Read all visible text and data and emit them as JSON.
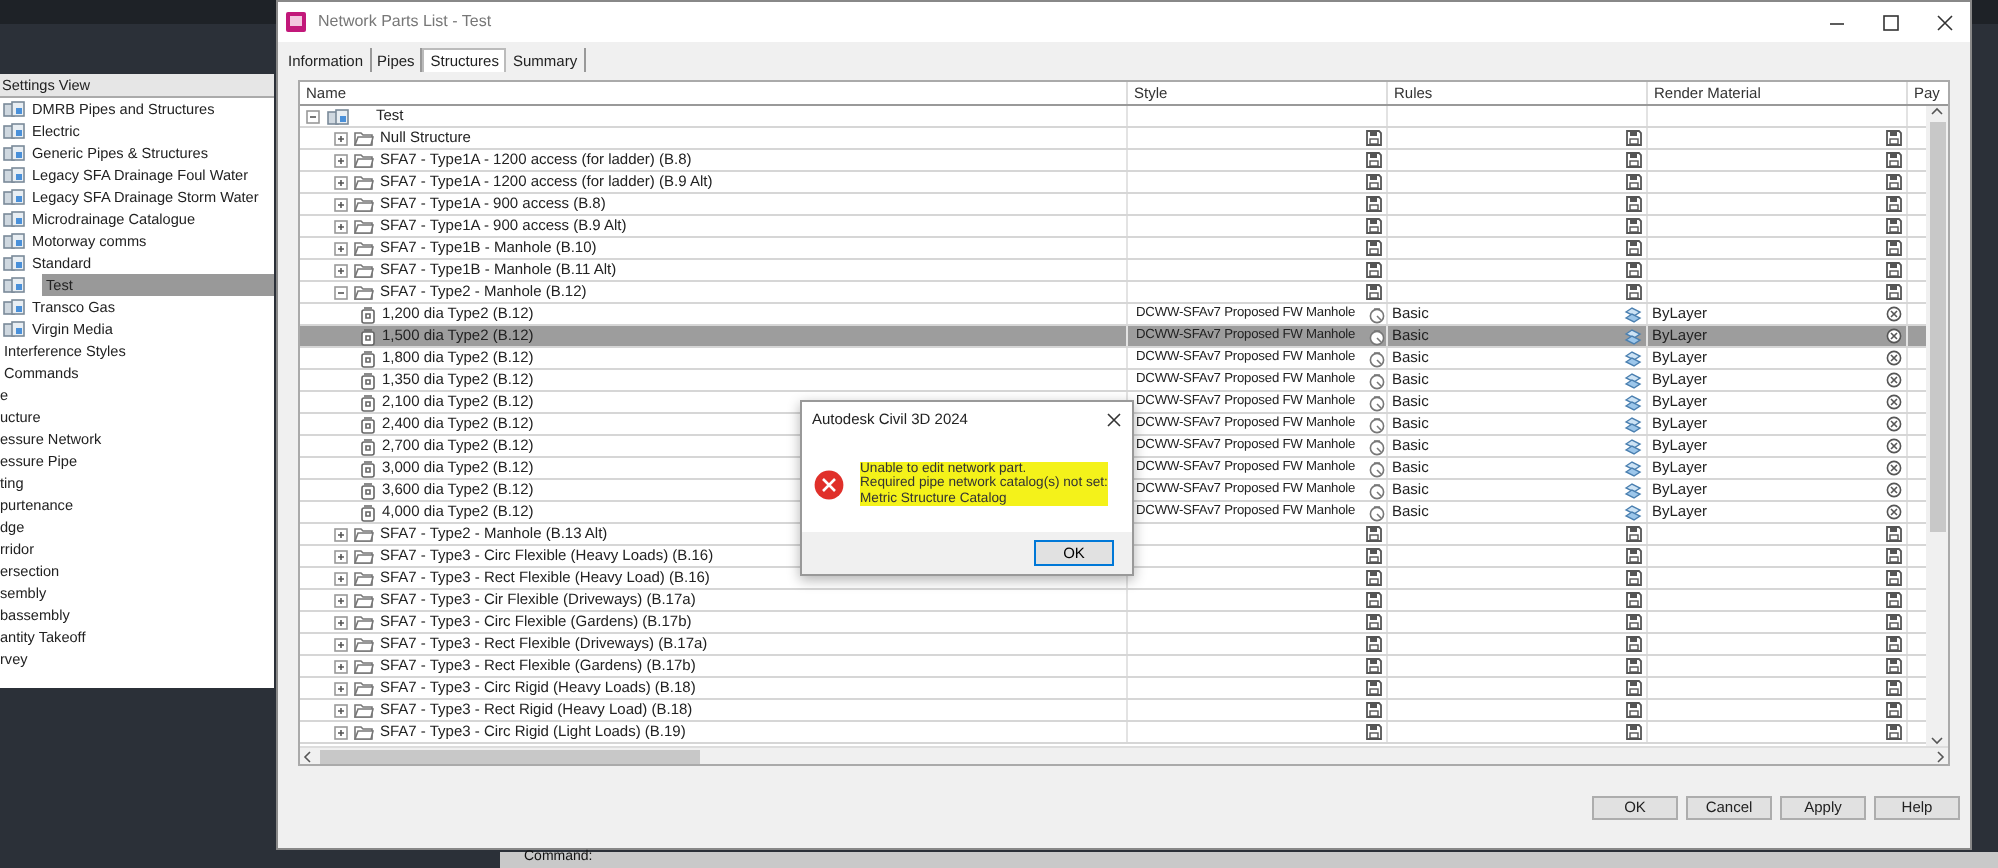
{
  "settings_view": {
    "header": "Settings View",
    "entries": [
      {
        "kind": "parts-list",
        "label": "DMRB Pipes and Structures",
        "selected": false
      },
      {
        "kind": "parts-list",
        "label": "Electric",
        "selected": false
      },
      {
        "kind": "parts-list",
        "label": "Generic Pipes & Structures",
        "selected": false
      },
      {
        "kind": "parts-list",
        "label": "Legacy SFA Drainage Foul Water",
        "selected": false
      },
      {
        "kind": "parts-list",
        "label": "Legacy SFA Drainage Storm Water",
        "selected": false
      },
      {
        "kind": "parts-list",
        "label": "Microdrainage Catalogue",
        "selected": false
      },
      {
        "kind": "parts-list",
        "label": "Motorway comms",
        "selected": false
      },
      {
        "kind": "parts-list",
        "label": "Standard",
        "selected": false
      },
      {
        "kind": "parts-list",
        "label": "Test",
        "selected": true
      },
      {
        "kind": "parts-list",
        "label": "Transco Gas",
        "selected": false
      },
      {
        "kind": "parts-list",
        "label": "Virgin Media",
        "selected": false
      },
      {
        "kind": "collection",
        "label": "Interference Styles",
        "selected": false
      },
      {
        "kind": "collection",
        "label": "Commands",
        "selected": false
      },
      {
        "kind": "object",
        "label": "e",
        "selected": false
      },
      {
        "kind": "object",
        "label": "ucture",
        "selected": false
      },
      {
        "kind": "object",
        "label": "essure Network",
        "selected": false
      },
      {
        "kind": "object",
        "label": "essure Pipe",
        "selected": false
      },
      {
        "kind": "object",
        "label": "ting",
        "selected": false
      },
      {
        "kind": "object",
        "label": "purtenance",
        "selected": false
      },
      {
        "kind": "object",
        "label": "dge",
        "selected": false
      },
      {
        "kind": "object",
        "label": "rridor",
        "selected": false
      },
      {
        "kind": "object",
        "label": "ersection",
        "selected": false
      },
      {
        "kind": "object",
        "label": "sembly",
        "selected": false
      },
      {
        "kind": "object",
        "label": "bassembly",
        "selected": false
      },
      {
        "kind": "object",
        "label": "antity Takeoff",
        "selected": false
      },
      {
        "kind": "object",
        "label": "rvey",
        "selected": false
      }
    ]
  },
  "dialog": {
    "title": "Network Parts List - Test",
    "tabs": [
      {
        "label": "Information",
        "selected": false
      },
      {
        "label": "Pipes",
        "selected": false
      },
      {
        "label": "Structures",
        "selected": true
      },
      {
        "label": "Summary",
        "selected": false
      }
    ],
    "columns": [
      "Name",
      "Style",
      "Rules",
      "Render Material",
      "Pay"
    ],
    "tree": {
      "kind": "root",
      "name": "Test",
      "expanded": true,
      "selected": false,
      "children": [
        {
          "kind": "family",
          "name": "Null Structure",
          "expanded": false,
          "selected": false
        },
        {
          "kind": "family",
          "name": "SFA7 - Type1A - 1200 access (for ladder) (B.8)",
          "expanded": false,
          "selected": false
        },
        {
          "kind": "family",
          "name": "SFA7 - Type1A - 1200 access (for ladder) (B.9 Alt)",
          "expanded": false,
          "selected": false
        },
        {
          "kind": "family",
          "name": "SFA7 - Type1A - 900 access (B.8)",
          "expanded": false,
          "selected": false
        },
        {
          "kind": "family",
          "name": "SFA7 - Type1A - 900 access (B.9 Alt)",
          "expanded": false,
          "selected": false
        },
        {
          "kind": "family",
          "name": "SFA7 - Type1B - Manhole (B.10)",
          "expanded": false,
          "selected": false
        },
        {
          "kind": "family",
          "name": "SFA7 - Type1B - Manhole (B.11 Alt)",
          "expanded": false,
          "selected": false
        },
        {
          "kind": "family",
          "name": "SFA7 - Type2 - Manhole (B.12)",
          "expanded": true,
          "selected": false,
          "children": [
            {
              "kind": "part",
              "name": "1,200 dia Type2 (B.12)",
              "style": "DCWW-SFAv7 Proposed FW Manhole",
              "rules": "Basic",
              "render_material": "ByLayer",
              "selected": false
            },
            {
              "kind": "part",
              "name": "1,500 dia Type2 (B.12)",
              "style": "DCWW-SFAv7 Proposed FW Manhole",
              "rules": "Basic",
              "render_material": "ByLayer",
              "selected": true
            },
            {
              "kind": "part",
              "name": "1,800 dia Type2 (B.12)",
              "style": "DCWW-SFAv7 Proposed FW Manhole",
              "rules": "Basic",
              "render_material": "ByLayer",
              "selected": false
            },
            {
              "kind": "part",
              "name": "1,350 dia Type2 (B.12)",
              "style": "DCWW-SFAv7 Proposed FW Manhole",
              "rules": "Basic",
              "render_material": "ByLayer",
              "selected": false
            },
            {
              "kind": "part",
              "name": "2,100 dia Type2 (B.12)",
              "style": "DCWW-SFAv7 Proposed FW Manhole",
              "rules": "Basic",
              "render_material": "ByLayer",
              "selected": false
            },
            {
              "kind": "part",
              "name": "2,400 dia Type2 (B.12)",
              "style": "DCWW-SFAv7 Proposed FW Manhole",
              "rules": "Basic",
              "render_material": "ByLayer",
              "selected": false
            },
            {
              "kind": "part",
              "name": "2,700 dia Type2 (B.12)",
              "style": "DCWW-SFAv7 Proposed FW Manhole",
              "rules": "Basic",
              "render_material": "ByLayer",
              "selected": false
            },
            {
              "kind": "part",
              "name": "3,000 dia Type2 (B.12)",
              "style": "DCWW-SFAv7 Proposed FW Manhole",
              "rules": "Basic",
              "render_material": "ByLayer",
              "selected": false
            },
            {
              "kind": "part",
              "name": "3,600 dia Type2 (B.12)",
              "style": "DCWW-SFAv7 Proposed FW Manhole",
              "rules": "Basic",
              "render_material": "ByLayer",
              "selected": false
            },
            {
              "kind": "part",
              "name": "4,000 dia Type2 (B.12)",
              "style": "DCWW-SFAv7 Proposed FW Manhole",
              "rules": "Basic",
              "render_material": "ByLayer",
              "selected": false
            }
          ]
        },
        {
          "kind": "family",
          "name": "SFA7 - Type2 - Manhole (B.13 Alt)",
          "expanded": false,
          "selected": false
        },
        {
          "kind": "family",
          "name": "SFA7 - Type3 - Circ Flexible (Heavy Loads) (B.16)",
          "expanded": false,
          "selected": false
        },
        {
          "kind": "family",
          "name": "SFA7 - Type3 - Rect Flexible (Heavy Load) (B.16)",
          "expanded": false,
          "selected": false
        },
        {
          "kind": "family",
          "name": "SFA7 - Type3 - Cir Flexible (Driveways) (B.17a)",
          "expanded": false,
          "selected": false
        },
        {
          "kind": "family",
          "name": "SFA7 - Type3 - Circ Flexible (Gardens) (B.17b)",
          "expanded": false,
          "selected": false
        },
        {
          "kind": "family",
          "name": "SFA7 - Type3 - Rect Flexible (Driveways) (B.17a)",
          "expanded": false,
          "selected": false
        },
        {
          "kind": "family",
          "name": "SFA7 - Type3 - Rect Flexible (Gardens) (B.17b)",
          "expanded": false,
          "selected": false
        },
        {
          "kind": "family",
          "name": "SFA7 - Type3 - Circ Rigid (Heavy Loads) (B.18)",
          "expanded": false,
          "selected": false
        },
        {
          "kind": "family",
          "name": "SFA7 - Type3 - Rect Rigid (Heavy Load) (B.18)",
          "expanded": false,
          "selected": false
        },
        {
          "kind": "family",
          "name": "SFA7 - Type3 - Circ Rigid (Light Loads) (B.19)",
          "expanded": false,
          "selected": false
        }
      ]
    },
    "buttons": [
      "OK",
      "Cancel",
      "Apply",
      "Help"
    ]
  },
  "message_box": {
    "title": "Autodesk Civil 3D 2024",
    "lines": [
      "Unable to edit network part.",
      "Required pipe network catalog(s) not set:",
      "Metric Structure Catalog"
    ],
    "highlighted": true,
    "button": "OK"
  },
  "command_line": {
    "prompt": "Command:"
  }
}
